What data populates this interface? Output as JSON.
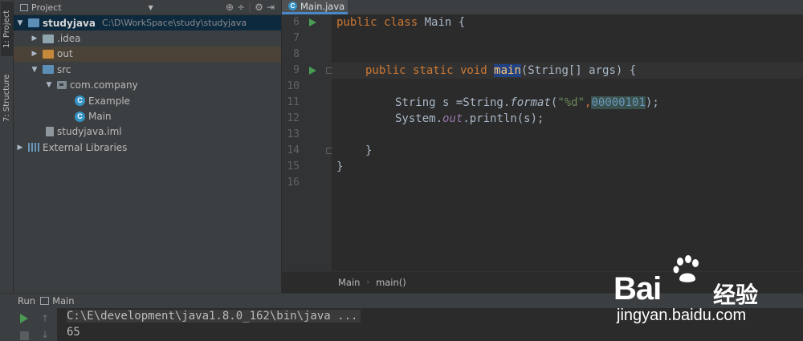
{
  "tool_strip": {
    "project_tab": "1: Project",
    "structure_tab": "7: Structure"
  },
  "project_panel": {
    "title": "Project",
    "tree": {
      "root": {
        "label": "studyjava",
        "path": "C:\\D\\WorkSpace\\study\\studyjava"
      },
      "idea": ".idea",
      "out": "out",
      "src": "src",
      "package": "com.company",
      "class_example": "Example",
      "class_main": "Main",
      "iml": "studyjava.iml",
      "libs": "External Libraries"
    }
  },
  "editor": {
    "tab_label": "Main.java",
    "line_numbers": [
      "6",
      "7",
      "8",
      "9",
      "10",
      "11",
      "12",
      "13",
      "14",
      "15",
      "16"
    ],
    "code": {
      "l6_kw": "public class",
      "l6_rest": " Main {",
      "l9_kw": "public static void",
      "l9_method": "main",
      "l9_rest": "(String[] args) {",
      "l11_a": "String s =String.",
      "l11_method": "format",
      "l11_b": "(",
      "l11_str": "\"%d\"",
      "l11_comma": ",",
      "l11_num": "00000101",
      "l11_end": ");",
      "l12_a": "System.",
      "l12_field": "out",
      "l12_b": ".println(s);",
      "l14": "}",
      "l15": "}"
    },
    "breadcrumb": {
      "class": "Main",
      "method": "main()"
    }
  },
  "run_window": {
    "label": "Run",
    "config": "Main",
    "console_line1": "C:\\E\\development\\java1.8.0_162\\bin\\java ...",
    "console_line2": "65"
  },
  "watermark": {
    "brand": "Bai",
    "brand2": "经验",
    "url": "jingyan.baidu.com"
  }
}
